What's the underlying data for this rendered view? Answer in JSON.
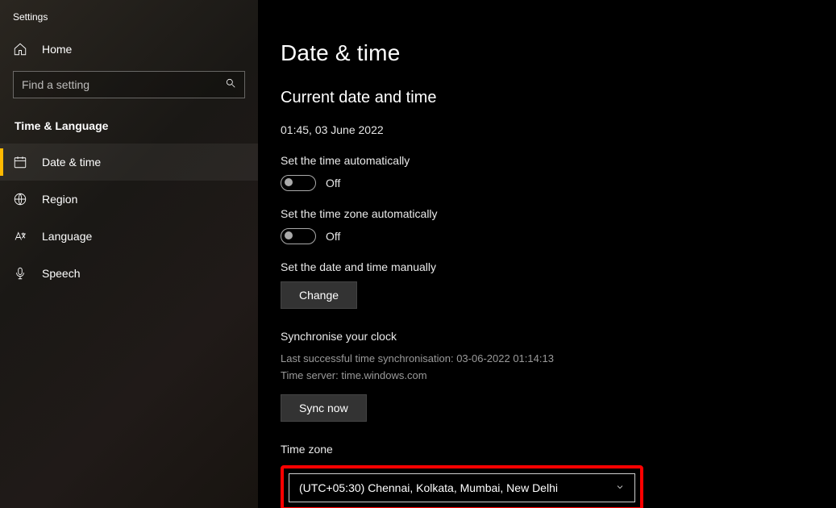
{
  "app_title": "Settings",
  "sidebar": {
    "home_label": "Home",
    "search_placeholder": "Find a setting",
    "section_heading": "Time & Language",
    "items": [
      {
        "label": "Date & time"
      },
      {
        "label": "Region"
      },
      {
        "label": "Language"
      },
      {
        "label": "Speech"
      }
    ]
  },
  "page": {
    "title": "Date & time",
    "current_heading": "Current date and time",
    "current_value": "01:45, 03 June 2022",
    "auto_time_label": "Set the time automatically",
    "auto_time_state": "Off",
    "auto_tz_label": "Set the time zone automatically",
    "auto_tz_state": "Off",
    "manual_label": "Set the date and time manually",
    "change_button": "Change",
    "sync_heading": "Synchronise your clock",
    "sync_last": "Last successful time synchronisation: 03-06-2022 01:14:13",
    "sync_server": "Time server: time.windows.com",
    "sync_button": "Sync now",
    "tz_label": "Time zone",
    "tz_selected": "(UTC+05:30) Chennai, Kolkata, Mumbai, New Delhi"
  }
}
